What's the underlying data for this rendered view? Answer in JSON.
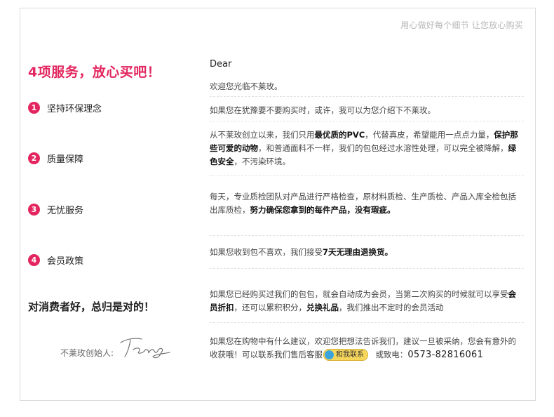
{
  "slogan": "用心做好每个细节 让您放心购买",
  "left": {
    "heading": "4项服务，放心买吧！",
    "items": [
      {
        "num": "1",
        "label": "坚持环保理念"
      },
      {
        "num": "2",
        "label": "质量保障"
      },
      {
        "num": "3",
        "label": "无忧服务"
      },
      {
        "num": "4",
        "label": "会员政策"
      }
    ],
    "consumer": "对消费者好，总归是对的！",
    "founder_label": "不莱玫创始人:",
    "signature": "Teng"
  },
  "right": {
    "dear": "Dear",
    "welcome": "欢迎您光临不莱玫。",
    "intro": "如果您在犹豫要不要购买时，或许，我可以为您介绍下不莱玫。",
    "p1": {
      "a": "从不莱玫创立以来，我们只用",
      "b": "最优质的PVC",
      "c": "，代替真皮，希望能用一点点力量，",
      "d": "保护那些可爱的动物",
      "e": "，和普通面料不一样，我们的包包经过水溶性处理，可以完全被降解，",
      "f": "绿色安全",
      "g": "，不污染环境。"
    },
    "p2": {
      "a": "每天，专业质检团队对产品进行严格检查，原材料质检、生产质检、产品入库全检包括出库质检，",
      "b": "努力确保您拿到的每件产品，没有瑕疵。"
    },
    "p3": {
      "a": "如果您收到包不喜欢，我们接受",
      "b": "7天无理由退换货。"
    },
    "p4": {
      "a": "如果您已经购买过我们的包包，就会自动成为会员，当第二次购买的时候就可以享受",
      "b": "会员折扣",
      "c": "，还可以累积积分，",
      "d": "兑换礼品",
      "e": "，我们推出不定时的会员活动"
    },
    "p5": {
      "a": "如果您在购物中有什么建议，欢迎您把想法告诉我们，建议一旦被采纳，您会有意外的收获哦！可以联系我们售后客服",
      "chat": "和我联系",
      "b": "或致电：",
      "phone": "0573-82816061"
    }
  },
  "colors": {
    "accent": "#e3265f",
    "border": "#dcdcdc",
    "slogan": "#b7b7b7",
    "chat_button": "#f7d65c"
  }
}
